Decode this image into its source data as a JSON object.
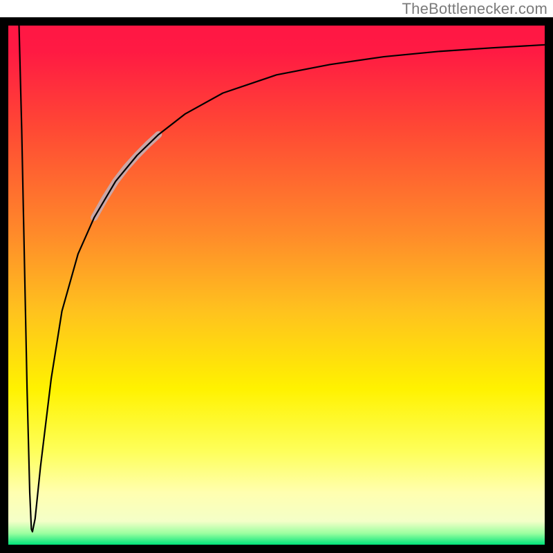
{
  "attribution": "TheBottlenecker.com",
  "chart_data": {
    "type": "line",
    "title": "",
    "xlabel": "",
    "ylabel": "",
    "xlim": [
      0,
      100
    ],
    "ylim": [
      0,
      100
    ],
    "background_gradient_stops": [
      {
        "offset": 0.0,
        "color": "#ff1744"
      },
      {
        "offset": 0.05,
        "color": "#ff1a43"
      },
      {
        "offset": 0.2,
        "color": "#ff4934"
      },
      {
        "offset": 0.4,
        "color": "#ff8a2a"
      },
      {
        "offset": 0.55,
        "color": "#ffc21e"
      },
      {
        "offset": 0.7,
        "color": "#fff200"
      },
      {
        "offset": 0.82,
        "color": "#feff5a"
      },
      {
        "offset": 0.9,
        "color": "#ffffb0"
      },
      {
        "offset": 0.955,
        "color": "#f4ffc8"
      },
      {
        "offset": 0.978,
        "color": "#9cffa0"
      },
      {
        "offset": 1.0,
        "color": "#00e37a"
      }
    ],
    "series": [
      {
        "name": "main-curve",
        "color": "#000000",
        "stroke_width": 2.2,
        "x": [
          2.0,
          2.5,
          3.0,
          3.5,
          4.0,
          4.3,
          4.5,
          5.0,
          6.0,
          8.0,
          10.0,
          13.0,
          16.0,
          20.0,
          24.0,
          28.0,
          33.0,
          40.0,
          50.0,
          60.0,
          70.0,
          80.0,
          90.0,
          100.0
        ],
        "values": [
          100,
          80,
          55,
          30,
          10,
          3,
          2.5,
          5,
          15,
          32,
          45,
          56,
          63,
          70,
          75,
          79,
          83,
          87,
          90.5,
          92.5,
          94,
          95,
          95.7,
          96.3
        ]
      }
    ],
    "highlight_segment": {
      "name": "emphasized-range",
      "color": "#caa6a6",
      "stroke_width": 10,
      "x": [
        16.0,
        18.0,
        20.0,
        22.0,
        24.0,
        26.0,
        28.0
      ],
      "values": [
        63,
        66.7,
        70,
        72.7,
        75,
        77.1,
        79
      ]
    },
    "frame": {
      "stroke": "#000000",
      "stroke_width": 12
    }
  }
}
